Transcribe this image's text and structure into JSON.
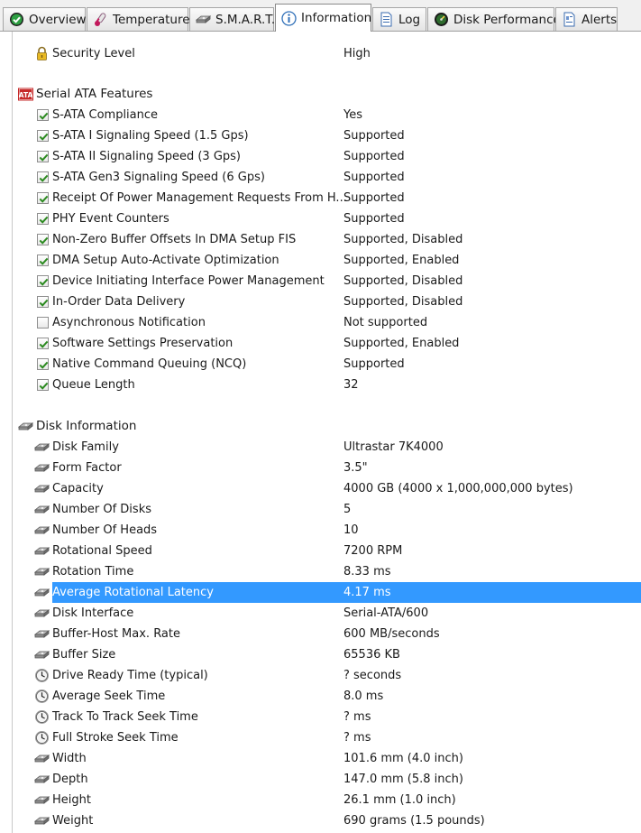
{
  "tabs": [
    {
      "label": "Overview",
      "icon": "green-check-icon",
      "active": false
    },
    {
      "label": "Temperature",
      "icon": "thermometer-icon",
      "active": false
    },
    {
      "label": "S.M.A.R.T.",
      "icon": "disk-icon",
      "active": false
    },
    {
      "label": "Information",
      "icon": "info-icon",
      "active": true
    },
    {
      "label": "Log",
      "icon": "document-icon",
      "active": false
    },
    {
      "label": "Disk Performance",
      "icon": "speedometer-icon",
      "active": false
    },
    {
      "label": "Alerts",
      "icon": "alert-document-icon",
      "active": false
    }
  ],
  "security": {
    "label": "Security Level",
    "value": "High",
    "icon": "padlock-icon"
  },
  "sata": {
    "title": "Serial ATA Features",
    "icon": "ata-badge-icon",
    "items": [
      {
        "label": "S-ATA Compliance",
        "value": "Yes",
        "checked": true
      },
      {
        "label": "S-ATA I Signaling Speed (1.5 Gps)",
        "value": "Supported",
        "checked": true
      },
      {
        "label": "S-ATA II Signaling Speed (3 Gps)",
        "value": "Supported",
        "checked": true
      },
      {
        "label": "S-ATA Gen3 Signaling Speed (6 Gps)",
        "value": "Supported",
        "checked": true
      },
      {
        "label": "Receipt Of Power Management Requests From H...",
        "value": "Supported",
        "checked": true
      },
      {
        "label": "PHY Event Counters",
        "value": "Supported",
        "checked": true
      },
      {
        "label": "Non-Zero Buffer Offsets In DMA Setup FIS",
        "value": "Supported, Disabled",
        "checked": true
      },
      {
        "label": "DMA Setup Auto-Activate Optimization",
        "value": "Supported, Enabled",
        "checked": true
      },
      {
        "label": "Device Initiating Interface Power Management",
        "value": "Supported, Disabled",
        "checked": true
      },
      {
        "label": "In-Order Data Delivery",
        "value": "Supported, Disabled",
        "checked": true
      },
      {
        "label": "Asynchronous Notification",
        "value": "Not supported",
        "checked": false
      },
      {
        "label": "Software Settings Preservation",
        "value": "Supported, Enabled",
        "checked": true
      },
      {
        "label": "Native Command Queuing (NCQ)",
        "value": "Supported",
        "checked": true
      },
      {
        "label": "Queue Length",
        "value": "32",
        "checked": true
      }
    ]
  },
  "disk": {
    "title": "Disk Information",
    "icon": "disk-icon",
    "items": [
      {
        "label": "Disk Family",
        "value": "Ultrastar 7K4000",
        "icon": "disk-icon",
        "selected": false
      },
      {
        "label": "Form Factor",
        "value": "3.5\"",
        "icon": "disk-icon",
        "selected": false
      },
      {
        "label": "Capacity",
        "value": "4000 GB (4000 x 1,000,000,000 bytes)",
        "icon": "disk-icon",
        "selected": false
      },
      {
        "label": "Number Of Disks",
        "value": "5",
        "icon": "disk-icon",
        "selected": false
      },
      {
        "label": "Number Of Heads",
        "value": "10",
        "icon": "disk-icon",
        "selected": false
      },
      {
        "label": "Rotational Speed",
        "value": "7200 RPM",
        "icon": "disk-icon",
        "selected": false
      },
      {
        "label": "Rotation Time",
        "value": "8.33 ms",
        "icon": "disk-icon",
        "selected": false
      },
      {
        "label": "Average Rotational Latency",
        "value": "4.17 ms",
        "icon": "disk-icon",
        "selected": true
      },
      {
        "label": "Disk Interface",
        "value": "Serial-ATA/600",
        "icon": "disk-icon",
        "selected": false
      },
      {
        "label": "Buffer-Host Max. Rate",
        "value": "600 MB/seconds",
        "icon": "disk-icon",
        "selected": false
      },
      {
        "label": "Buffer Size",
        "value": "65536 KB",
        "icon": "disk-icon",
        "selected": false
      },
      {
        "label": "Drive Ready Time (typical)",
        "value": "? seconds",
        "icon": "clock-icon",
        "selected": false
      },
      {
        "label": "Average Seek Time",
        "value": "8.0 ms",
        "icon": "clock-icon",
        "selected": false
      },
      {
        "label": "Track To Track Seek Time",
        "value": "? ms",
        "icon": "clock-icon",
        "selected": false
      },
      {
        "label": "Full Stroke Seek Time",
        "value": "? ms",
        "icon": "clock-icon",
        "selected": false
      },
      {
        "label": "Width",
        "value": "101.6 mm (4.0 inch)",
        "icon": "disk-icon",
        "selected": false
      },
      {
        "label": "Depth",
        "value": "147.0 mm (5.8 inch)",
        "icon": "disk-icon",
        "selected": false
      },
      {
        "label": "Height",
        "value": "26.1 mm (1.0 inch)",
        "icon": "disk-icon",
        "selected": false
      },
      {
        "label": "Weight",
        "value": "690 grams (1.5 pounds)",
        "icon": "disk-icon",
        "selected": false
      }
    ]
  },
  "colors": {
    "selection": "#3399ff",
    "check": "#2b8a1f",
    "ata_badge": "#c62828"
  }
}
